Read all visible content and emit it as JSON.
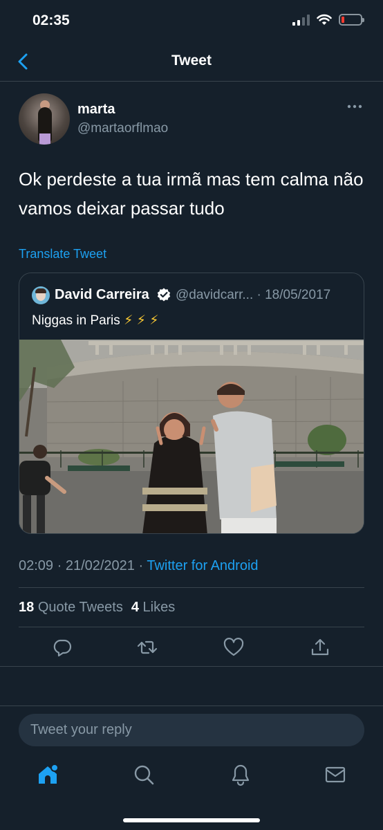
{
  "status_bar": {
    "time": "02:35"
  },
  "header": {
    "title": "Tweet"
  },
  "tweet": {
    "author_name": "marta",
    "author_handle": "@martaorflmao",
    "text": "Ok perdeste a tua irmã mas tem calma não vamos deixar passar tudo",
    "translate_label": "Translate Tweet",
    "time": "02:09 · 21/02/2021 · ",
    "source": "Twitter for Android"
  },
  "quote": {
    "author_name": "David Carreira",
    "meta": "@davidcarr... · 18/05/2017",
    "text": "Niggas in Paris ",
    "emoji": "⚡ ⚡ ⚡"
  },
  "stats": {
    "quote_count": "18",
    "quote_label": "Quote Tweets",
    "like_count": "4",
    "like_label": "Likes"
  },
  "reply": {
    "placeholder": "Tweet your reply"
  },
  "colors": {
    "background": "#15202b",
    "accent": "#1da1f2",
    "muted": "#8899a6",
    "border": "#38444d"
  },
  "icons": [
    "chevron-left-icon",
    "more-icon",
    "verified-icon",
    "reply-icon",
    "retweet-icon",
    "like-icon",
    "share-icon",
    "home-icon",
    "search-icon",
    "notifications-icon",
    "messages-icon"
  ]
}
